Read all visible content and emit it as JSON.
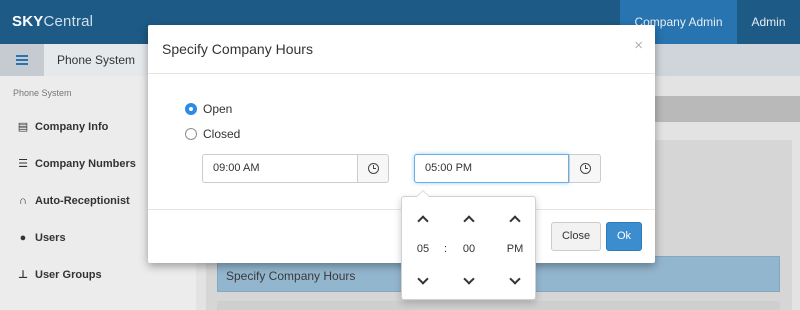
{
  "app": {
    "brand_bold": "SKY",
    "brand_rest": "Central",
    "menu_company": "Company Admin",
    "menu_admin": "Admin"
  },
  "subnav": {
    "tab_label": "Phone System"
  },
  "sidebar": {
    "caption": "Phone System",
    "items": [
      {
        "label": "Company Info",
        "icon": "id-card-icon"
      },
      {
        "label": "Company Numbers",
        "icon": "list-icon"
      },
      {
        "label": "Auto-Receptionist",
        "icon": "headphones-icon"
      },
      {
        "label": "Users",
        "icon": "users-icon"
      },
      {
        "label": "User Groups",
        "icon": "sitemap-icon"
      }
    ]
  },
  "content": {
    "accordion_title": "Specify Company Hours"
  },
  "modal": {
    "title": "Specify Company Hours",
    "close_glyph": "×",
    "options": [
      {
        "label": "Open",
        "checked": true
      },
      {
        "label": "Closed",
        "checked": false
      }
    ],
    "start_time": "09:00 AM",
    "end_time": "05:00 PM",
    "close_button": "Close",
    "ok_button": "Ok"
  },
  "time_picker": {
    "hour": "05",
    "separator": ":",
    "minute": "00",
    "meridian": "PM"
  },
  "colors": {
    "topbar": "#1d5a86",
    "accent": "#3c8dcd",
    "radio_checked": "#2d8ae6"
  }
}
